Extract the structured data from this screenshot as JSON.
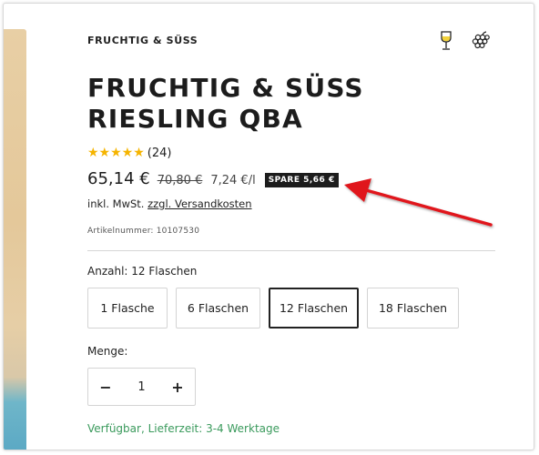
{
  "brand": "FRUCHTIG & SÜSS",
  "product": {
    "title": "FRUCHTIG & SÜSS RIESLING QBA",
    "rating": {
      "stars": "★★★★★",
      "value": 5,
      "count_text": "(24)"
    },
    "price": "65,14 €",
    "old_price": "70,80 €",
    "unit_price": "7,24 €/l",
    "save_badge": "SPARE 5,66 €",
    "tax_prefix": "inkl. MwSt.",
    "shipping_link": "zzgl. Versandkosten",
    "sku": "Artikelnummer: 10107530"
  },
  "quantity": {
    "label": "Anzahl:",
    "selected_value": "12 Flaschen",
    "options": [
      "1 Flasche",
      "6 Flaschen",
      "12 Flaschen",
      "18 Flaschen"
    ],
    "selected_index": 2
  },
  "menge": {
    "label": "Menge:",
    "minus": "−",
    "value": "1",
    "plus": "+"
  },
  "availability": "Verfügbar, Lieferzeit: 3-4 Werktage",
  "icons": [
    "wine-glass-icon",
    "grapes-icon"
  ],
  "colors": {
    "star": "#f5b400",
    "badge_bg": "#1c1c1c",
    "availability": "#3a9a5c",
    "annotation_arrow": "#e0191e"
  }
}
